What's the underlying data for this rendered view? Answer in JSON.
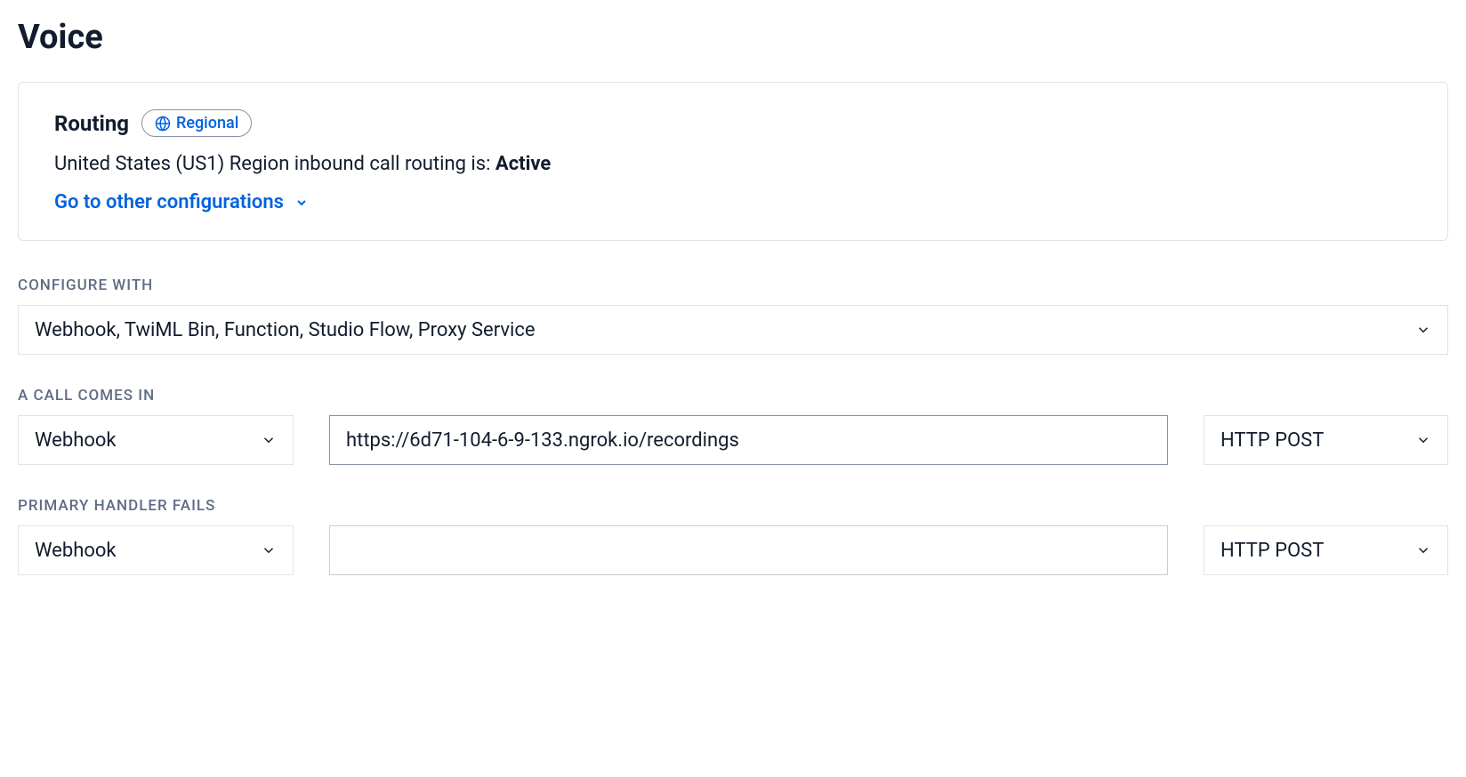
{
  "title": "Voice",
  "routing": {
    "label": "Routing",
    "badge": "Regional",
    "status_prefix": "United States (US1) Region inbound call routing is: ",
    "status_value": "Active",
    "link": "Go to other configurations"
  },
  "configure_with": {
    "label": "CONFIGURE WITH",
    "value": "Webhook, TwiML Bin, Function, Studio Flow, Proxy Service"
  },
  "call_comes_in": {
    "label": "A CALL COMES IN",
    "type": "Webhook",
    "url": "https://6d71-104-6-9-133.ngrok.io/recordings",
    "method": "HTTP POST"
  },
  "primary_handler_fails": {
    "label": "PRIMARY HANDLER FAILS",
    "type": "Webhook",
    "url": "",
    "method": "HTTP POST"
  }
}
